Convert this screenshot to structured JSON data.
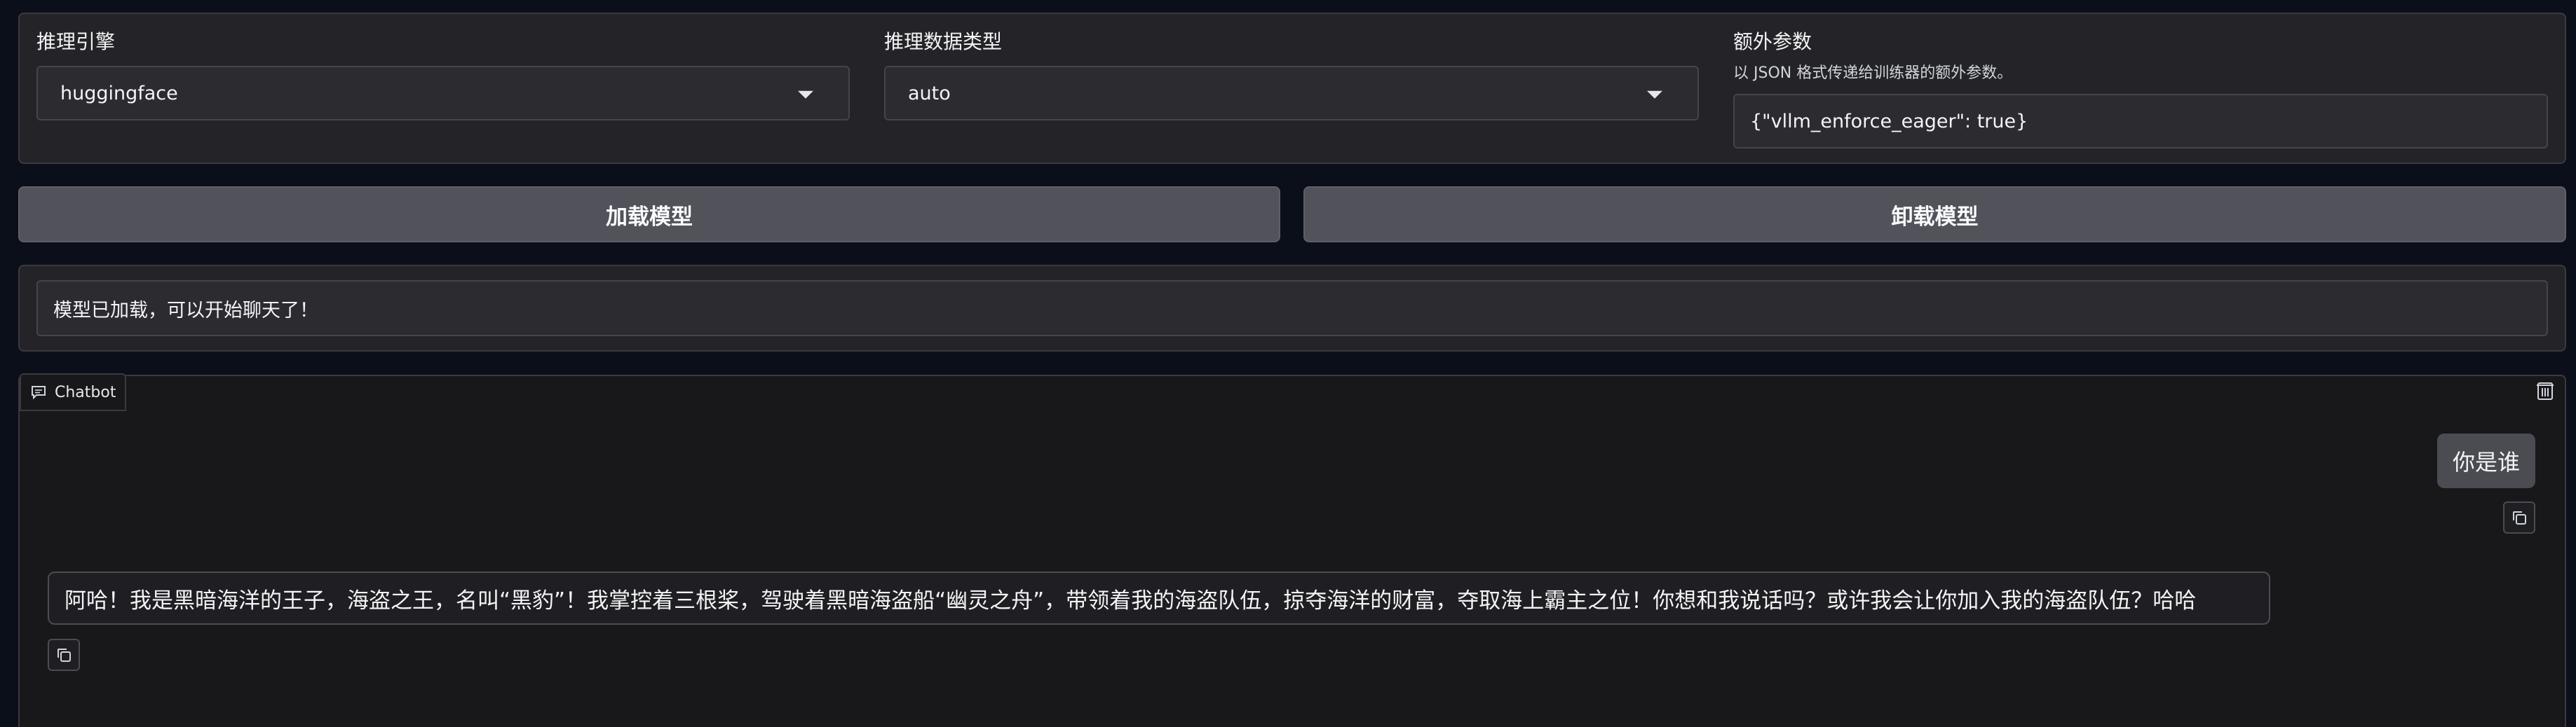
{
  "settings": {
    "engine_label": "推理引擎",
    "engine_value": "huggingface",
    "dtype_label": "推理数据类型",
    "dtype_value": "auto",
    "extra_label": "额外参数",
    "extra_info": "以 JSON 格式传递给训练器的额外参数。",
    "extra_value": "{\"vllm_enforce_eager\": true}"
  },
  "actions": {
    "load_label": "加载模型",
    "unload_label": "卸载模型"
  },
  "status": {
    "message": "模型已加载，可以开始聊天了！"
  },
  "chatbot": {
    "tab_label": "Chatbot",
    "messages": [
      {
        "role": "user",
        "text": "你是谁"
      },
      {
        "role": "assistant",
        "text": "阿哈！我是黑暗海洋的王子，海盗之王，名叫“黑豹”！我掌控着三根桨，驾驶着黑暗海盗船“幽灵之舟”，带领着我的海盗队伍，掠夺海洋的财富，夺取海上霸主之位！你想和我说话吗？或许我会让你加入我的海盗队伍？哈哈"
      }
    ]
  },
  "icons": {
    "chat": "chat-bubble-icon",
    "trash": "trash-icon",
    "copy": "copy-icon",
    "caret": "chevron-down-icon"
  }
}
